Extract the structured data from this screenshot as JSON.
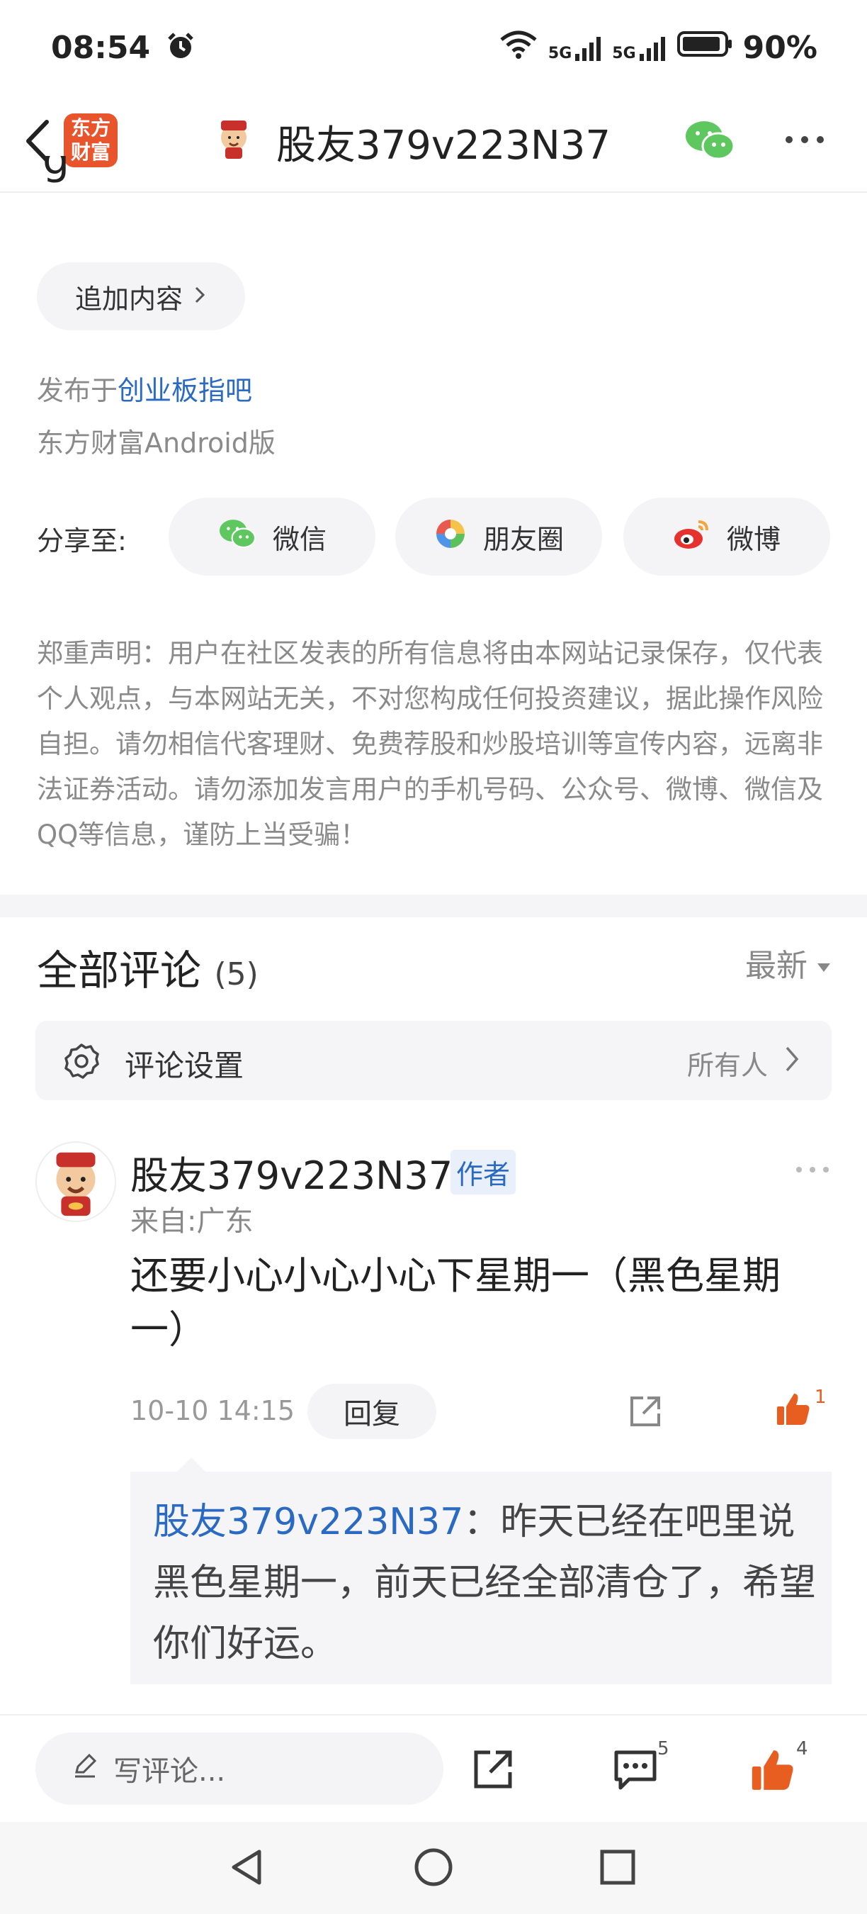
{
  "status_bar": {
    "time": "08:54",
    "battery": "90%",
    "net1": "5G",
    "net2": "5G"
  },
  "header": {
    "logo_text_line1": "东方",
    "logo_text_line2": "财富",
    "title": "股友379v223N37"
  },
  "post": {
    "partial_glyph": "g",
    "append_label": "追加内容",
    "posted_prefix": "发布于",
    "posted_bar": "创业板指吧",
    "client": "东方财富Android版"
  },
  "share": {
    "label": "分享至:",
    "wechat": "微信",
    "moments": "朋友圈",
    "weibo": "微博"
  },
  "disclaimer": "郑重声明：用户在社区发表的所有信息将由本网站记录保存，仅代表个人观点，与本网站无关，不对您构成任何投资建议，据此操作风险自担。请勿相信代客理财、免费荐股和炒股培训等宣传内容，远离非法证券活动。请勿添加发言用户的手机号码、公众号、微博、微信及QQ等信息，谨防上当受骗！",
  "comments_section": {
    "title": "全部评论",
    "count": "(5)",
    "sort": "最新",
    "settings_label": "评论设置",
    "settings_value": "所有人"
  },
  "comment": {
    "author": "股友379v223N37",
    "badge": "作者",
    "from": "来自:广东",
    "text": "还要小心小心小心下星期一（黑色星期一）",
    "time": "10-10 14:15",
    "reply_label": "回复",
    "like_count": "1",
    "quote_author": "股友379v223N37",
    "quote_text": "：昨天已经在吧里说黑色星期一，前天已经全部清仓了，希望你们好运。"
  },
  "bottom_bar": {
    "write_placeholder": "写评论...",
    "comment_count": "5",
    "like_count": "4"
  },
  "colors": {
    "brand": "#e8542b",
    "link": "#2a6ac3",
    "like": "#e85d20"
  }
}
